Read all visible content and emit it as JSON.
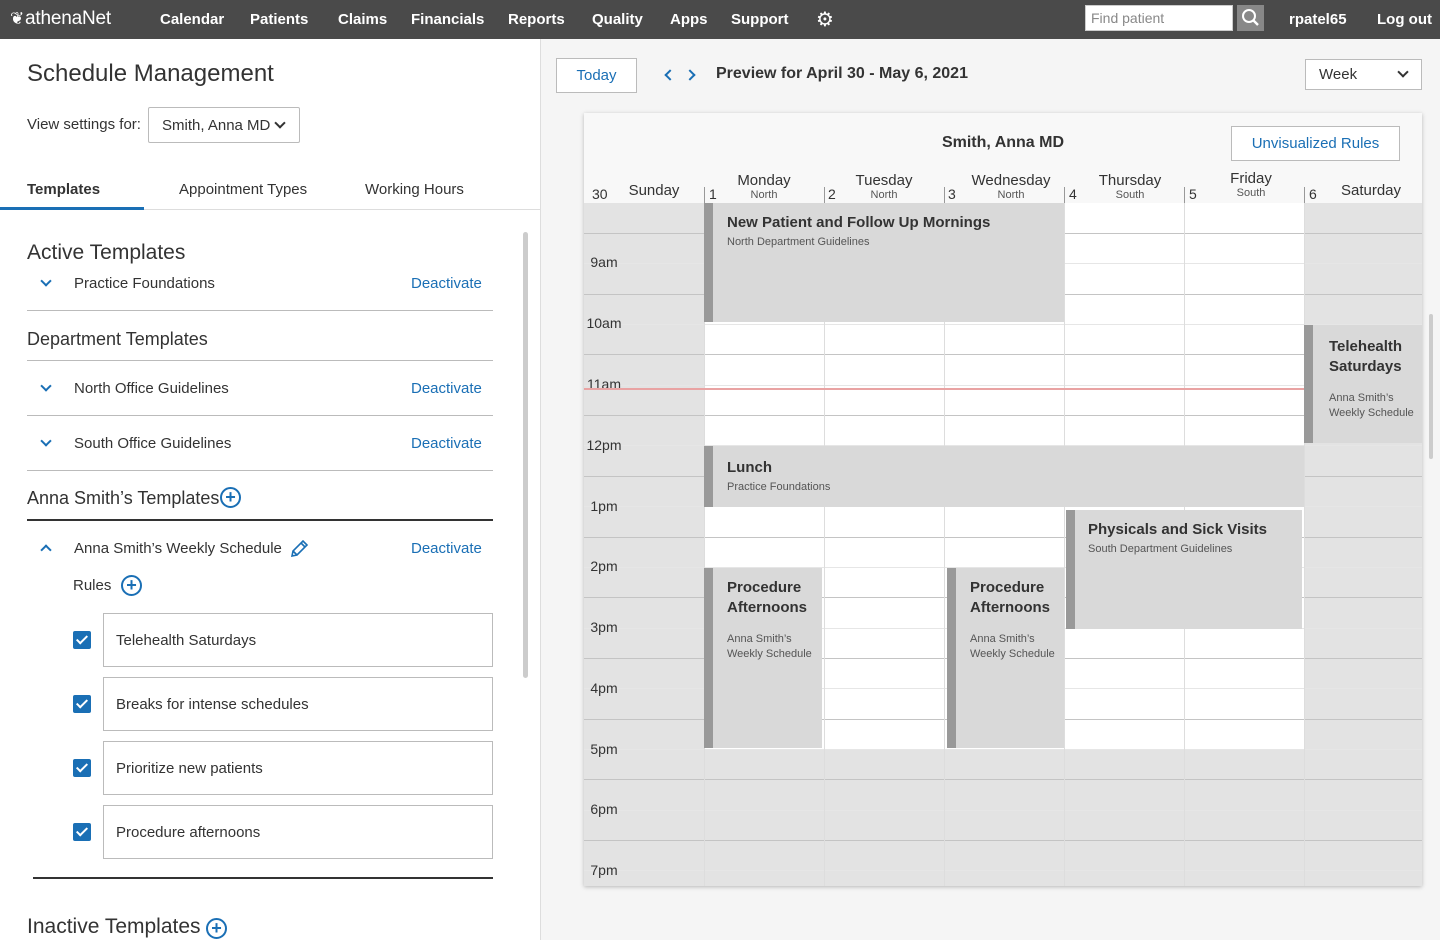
{
  "nav": {
    "logo": "athenaNet",
    "items": [
      "Calendar",
      "Patients",
      "Claims",
      "Financials",
      "Reports",
      "Quality",
      "Apps",
      "Support"
    ],
    "search_placeholder": "Find patient",
    "username": "rpatel65",
    "logout": "Log out"
  },
  "left": {
    "title": "Schedule Management",
    "view_label": "View settings for:",
    "provider": "Smith, Anna MD",
    "tabs": [
      "Templates",
      "Appointment Types",
      "Working Hours"
    ],
    "active_templates_title": "Active Templates",
    "practice_foundations": "Practice Foundations",
    "department_templates_title": "Department Templates",
    "north_office": "North Office Guidelines",
    "south_office": "South Office Guidelines",
    "anna_templates_title": "Anna Smith’s Templates",
    "weekly_schedule": "Anna Smith’s Weekly Schedule",
    "deactivate": "Deactivate",
    "rules_label": "Rules",
    "rules": [
      "Telehealth Saturdays",
      "Breaks for intense schedules",
      "Prioritize new patients",
      "Procedure afternoons"
    ],
    "inactive_templates_title": "Inactive Templates"
  },
  "right": {
    "today": "Today",
    "preview_title": "Preview for April 30 -  May 6, 2021",
    "view_mode": "Week",
    "calendar": {
      "provider": "Smith, Anna MD",
      "unvisualized": "Unvisualized Rules",
      "days": [
        {
          "num": "30",
          "name": "Sunday",
          "dept": ""
        },
        {
          "num": "1",
          "name": "Monday",
          "dept": "North"
        },
        {
          "num": "2",
          "name": "Tuesday",
          "dept": "North"
        },
        {
          "num": "3",
          "name": "Wednesday",
          "dept": "North"
        },
        {
          "num": "4",
          "name": "Thursday",
          "dept": "South"
        },
        {
          "num": "5",
          "name": "Friday",
          "dept": "South"
        },
        {
          "num": "6",
          "name": "Saturday",
          "dept": ""
        }
      ],
      "times": [
        "9am",
        "10am",
        "11am",
        "12pm",
        "1pm",
        "2pm",
        "3pm",
        "4pm",
        "5pm",
        "6pm",
        "7pm"
      ],
      "events": {
        "new_patient": {
          "title": "New Patient and Follow Up Mornings",
          "sub": "North Department Guidelines"
        },
        "telehealth": {
          "title": "Telehealth Saturdays",
          "sub": "Anna Smith’s Weekly Schedule"
        },
        "lunch": {
          "title": "Lunch",
          "sub": "Practice Foundations"
        },
        "physicals": {
          "title": "Physicals and Sick Visits",
          "sub": "South Department Guidelines"
        },
        "procedure_mon": {
          "title": "Procedure Afternoons",
          "sub": "Anna Smith’s Weekly Schedule"
        },
        "procedure_wed": {
          "title": "Procedure Afternoons",
          "sub": "Anna Smith’s Weekly Schedule"
        }
      }
    }
  }
}
